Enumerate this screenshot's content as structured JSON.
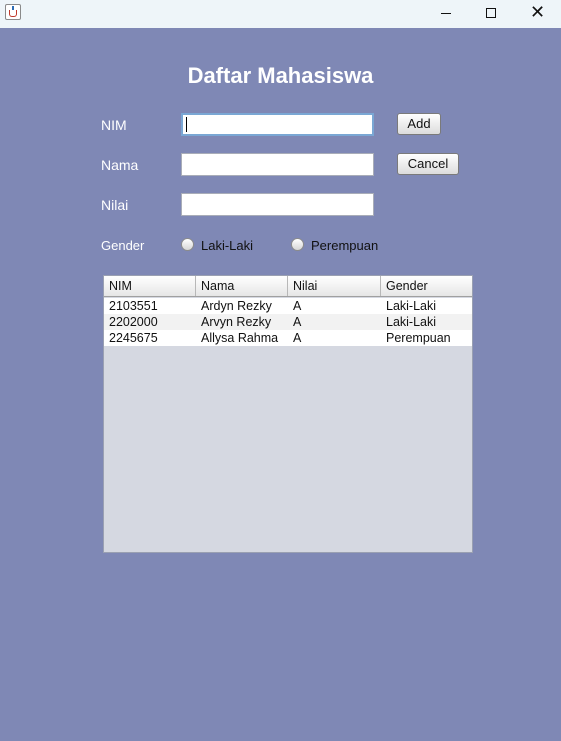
{
  "window": {
    "title": ""
  },
  "form": {
    "title": "Daftar Mahasiswa",
    "labels": {
      "nim": "NIM",
      "nama": "Nama",
      "nilai": "Nilai",
      "gender": "Gender"
    },
    "fields": {
      "nim": "",
      "nama": "",
      "nilai": ""
    },
    "buttons": {
      "add": "Add",
      "cancel": "Cancel"
    },
    "gender_options": [
      "Laki-Laki",
      "Perempuan"
    ]
  },
  "table": {
    "columns": [
      "NIM",
      "Nama",
      "Nilai",
      "Gender"
    ],
    "rows": [
      [
        "2103551",
        "Ardyn Rezky",
        "A",
        "Laki-Laki"
      ],
      [
        "2202000",
        "Arvyn Rezky",
        "A",
        "Laki-Laki"
      ],
      [
        "2245675",
        "Allysa Rahma",
        "A",
        "Perempuan"
      ]
    ]
  },
  "colors": {
    "background": "#7f88b5",
    "titlebar": "#eef5f9",
    "table_empty": "#d5d8e1"
  },
  "icons": [
    "java-app-icon",
    "minimize-icon",
    "maximize-icon",
    "close-icon",
    "radio-icon"
  ]
}
